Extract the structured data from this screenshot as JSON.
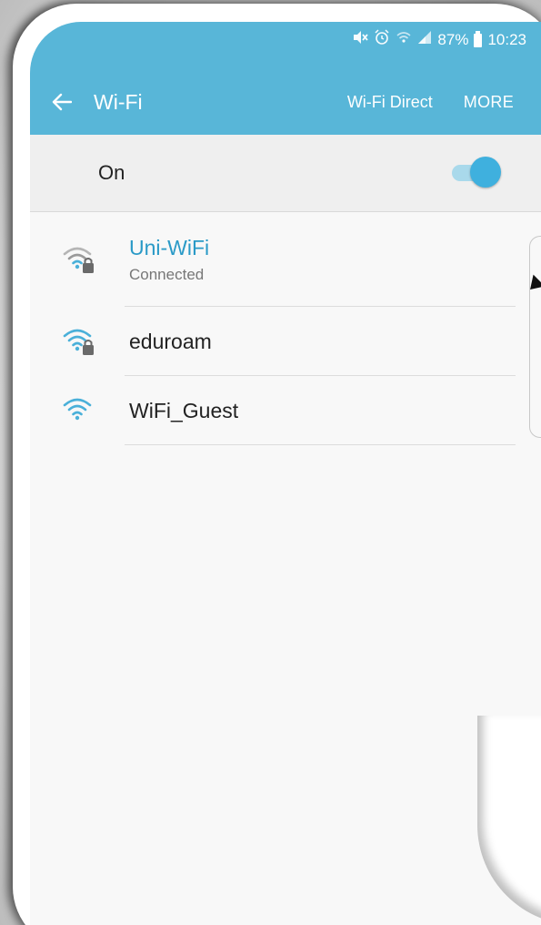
{
  "status_bar": {
    "battery": "87%",
    "time": "10:23",
    "icons": [
      "mute-icon",
      "alarm-icon",
      "wifi-status-icon",
      "signal-icon",
      "battery-icon"
    ]
  },
  "toolbar": {
    "title": "Wi-Fi",
    "back_icon": "arrow-left-icon",
    "wifi_direct_label": "Wi-Fi Direct",
    "more_label": "MORE"
  },
  "toggle": {
    "label": "On",
    "state": true
  },
  "networks": [
    {
      "name": "Uni-WiFi",
      "status": "Connected",
      "secured": true,
      "connected": true
    },
    {
      "name": "eduroam",
      "status": "",
      "secured": true,
      "connected": false
    },
    {
      "name": "WiFi_Guest",
      "status": "",
      "secured": false,
      "connected": false
    }
  ],
  "colors": {
    "appbar": "#58b6d8",
    "accent": "#2a9ac7",
    "switch_thumb": "#3fb0de",
    "switch_track": "#a9d9eb"
  }
}
